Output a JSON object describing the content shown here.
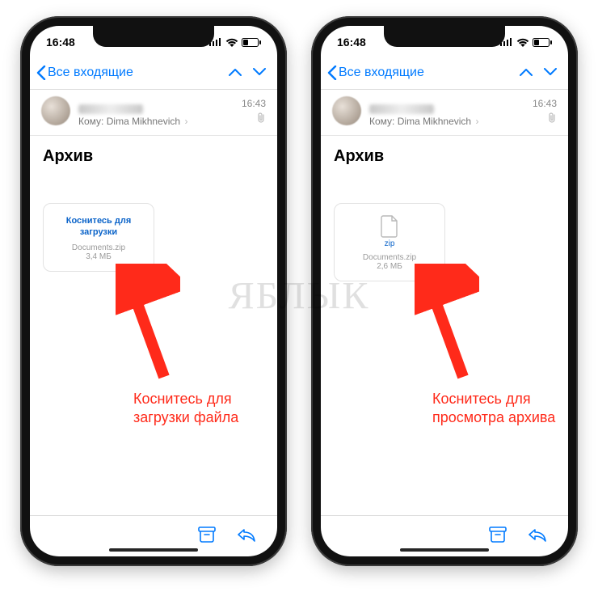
{
  "watermark": "ЯБЛЫК",
  "statusbar": {
    "time": "16:48"
  },
  "navbar": {
    "back_label": "Все входящие"
  },
  "message": {
    "to_prefix": "Кому:",
    "to_name": "Dima Mikhnevich",
    "time": "16:43",
    "subject": "Архив"
  },
  "left": {
    "attachment": {
      "cta_line1": "Коснитесь для",
      "cta_line2": "загрузки",
      "filename": "Documents.zip",
      "size": "3,4 МБ"
    },
    "caption_line1": "Коснитесь для",
    "caption_line2": "загрузки файла"
  },
  "right": {
    "attachment": {
      "ext_label": "zip",
      "filename": "Documents.zip",
      "size": "2,6 МБ"
    },
    "caption_line1": "Коснитесь для",
    "caption_line2": "просмотра архива"
  }
}
